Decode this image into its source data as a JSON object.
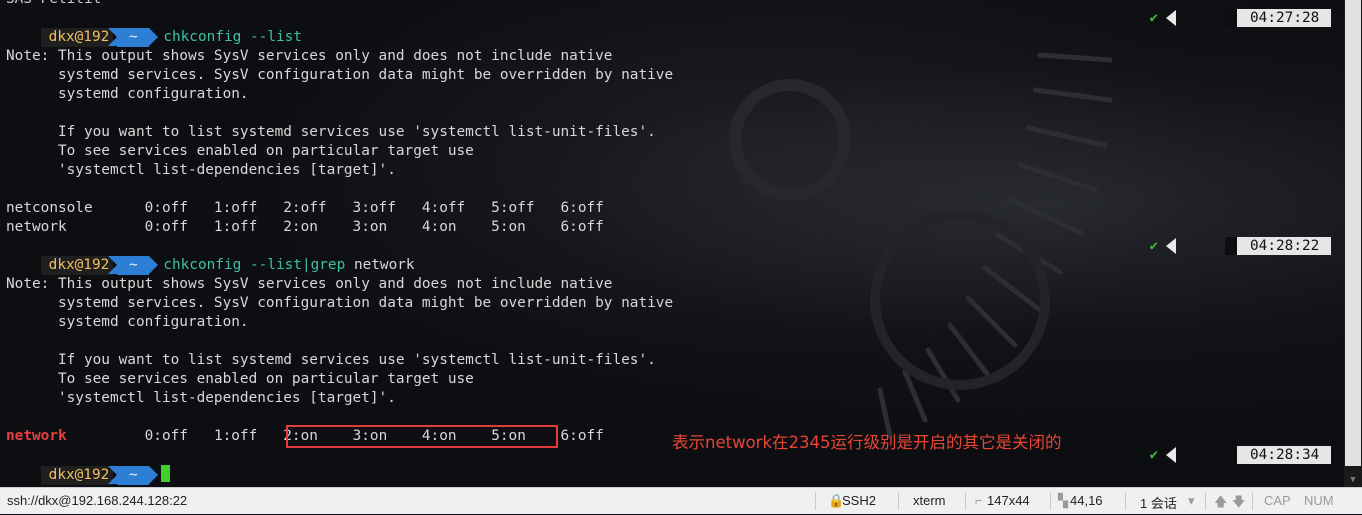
{
  "top_partial": "SAS Petitit",
  "prompt": {
    "user_host": "dkx@192",
    "dir": "~"
  },
  "commands": {
    "c1": "chkconfig --list",
    "c2_prefix": "chkconfig --list",
    "c2_pipe": "|grep",
    "c2_arg": "network"
  },
  "note_lines": [
    "Note: This output shows SysV services only and does not include native",
    "      systemd services. SysV configuration data might be overridden by native",
    "      systemd configuration.",
    "",
    "      If you want to list systemd services use 'systemctl list-unit-files'.",
    "      To see services enabled on particular target use",
    "      'systemctl list-dependencies [target]'."
  ],
  "services_block1": [
    "netconsole      0:off   1:off   2:off   3:off   4:off   5:off   6:off",
    "network         0:off   1:off   2:on    3:on    4:on    5:on    6:off"
  ],
  "grep_result": {
    "name": "network",
    "pre": "         0:off   1:off   ",
    "boxed": "2:on    3:on    4:on    5:on",
    "post": "    6:off"
  },
  "timestamps": [
    "04:27:28",
    "04:28:22",
    "04:28:34"
  ],
  "check_mark": "✔",
  "annotation": "表示network在2345运行级别是开启的其它是关闭的",
  "statusbar": {
    "connection": "ssh://dkx@192.168.244.128:22",
    "protocol": "SSH2",
    "terminal": "xterm",
    "size": "147x44",
    "position": "44,16",
    "sessions": "1 会话",
    "cap": "CAP",
    "num": "NUM"
  },
  "colors": {
    "prompt_arrow": "#2d7fd6",
    "command": "#3ec0a6",
    "highlight_red": "#e23b3b",
    "cursor": "#3fd02a"
  }
}
